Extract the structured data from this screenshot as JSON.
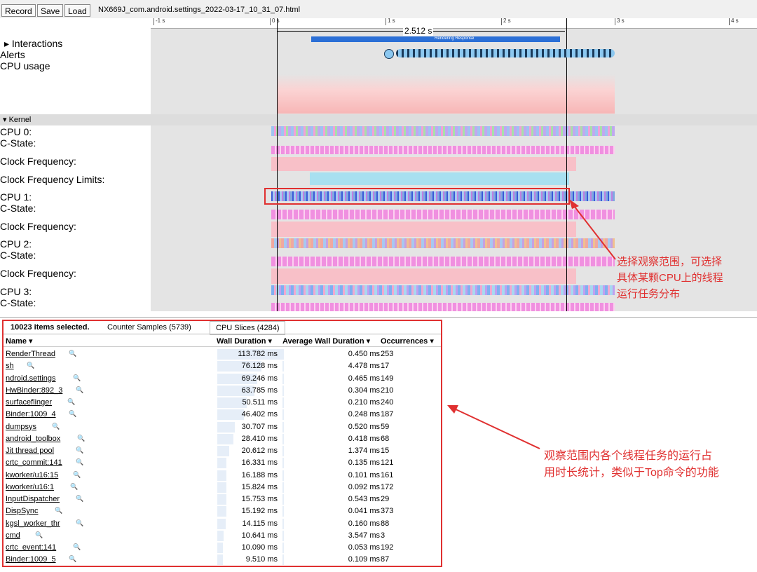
{
  "toolbar": {
    "record": "Record",
    "save": "Save",
    "load": "Load",
    "filename": "NX669J_com.android.settings_2022-03-17_10_31_07.html"
  },
  "ruler": {
    "ticks": [
      "-1 s",
      "0 s",
      "1 s",
      "2 s",
      "3 s",
      "4 s"
    ],
    "selection_duration": "2.512 s",
    "slice_label": "Rendering Response"
  },
  "tracks": {
    "interactions": "▸ Interactions",
    "alerts": "Alerts",
    "cpu_usage": "CPU usage",
    "kernel": "▾ Kernel",
    "cpu0": "CPU 0:",
    "cstate0": "C-State:",
    "clock0": "Clock Frequency:",
    "clocklim0": "Clock Frequency Limits:",
    "cpu1": "CPU 1:",
    "cstate1": "C-State:",
    "clock1": "Clock Frequency:",
    "cpu2": "CPU 2:",
    "cstate2": "C-State:",
    "clock2": "Clock Frequency:",
    "cpu3": "CPU 3:",
    "cstate3": "C-State:"
  },
  "annotation_top": [
    "选择观察范围，可选择",
    "具体某颗CPU上的线程",
    "运行任务分布"
  ],
  "annotation_bottom": [
    "观察范围内各个线程任务的运行占",
    "用时长统计，类似于Top命令的功能"
  ],
  "panel": {
    "selected": "10023 items selected.",
    "tab_counter": "Counter Samples (5739)",
    "tab_cpu": "CPU Slices (4284)",
    "col_name": "Name",
    "col_wall": "Wall Duration",
    "col_avg": "Average Wall Duration",
    "col_occ": "Occurrences",
    "sort_arrow": "▾"
  },
  "rows": [
    {
      "name": "RenderThread",
      "wall": "113.782 ms",
      "avg": "0.450 ms",
      "occ": "253",
      "wall_ms": 113.782
    },
    {
      "name": "sh",
      "wall": "76.128 ms",
      "avg": "4.478 ms",
      "occ": "17",
      "wall_ms": 76.128
    },
    {
      "name": "ndroid.settings",
      "wall": "69.246 ms",
      "avg": "0.465 ms",
      "occ": "149",
      "wall_ms": 69.246
    },
    {
      "name": "HwBinder:892_3",
      "wall": "63.785 ms",
      "avg": "0.304 ms",
      "occ": "210",
      "wall_ms": 63.785
    },
    {
      "name": "surfaceflinger",
      "wall": "50.511 ms",
      "avg": "0.210 ms",
      "occ": "240",
      "wall_ms": 50.511
    },
    {
      "name": "Binder:1009_4",
      "wall": "46.402 ms",
      "avg": "0.248 ms",
      "occ": "187",
      "wall_ms": 46.402
    },
    {
      "name": "dumpsys",
      "wall": "30.707 ms",
      "avg": "0.520 ms",
      "occ": "59",
      "wall_ms": 30.707
    },
    {
      "name": "android_toolbox",
      "wall": "28.410 ms",
      "avg": "0.418 ms",
      "occ": "68",
      "wall_ms": 28.41
    },
    {
      "name": "Jit thread pool",
      "wall": "20.612 ms",
      "avg": "1.374 ms",
      "occ": "15",
      "wall_ms": 20.612
    },
    {
      "name": "crtc_commit:141",
      "wall": "16.331 ms",
      "avg": "0.135 ms",
      "occ": "121",
      "wall_ms": 16.331
    },
    {
      "name": "kworker/u16:15",
      "wall": "16.188 ms",
      "avg": "0.101 ms",
      "occ": "161",
      "wall_ms": 16.188
    },
    {
      "name": "kworker/u16:1",
      "wall": "15.824 ms",
      "avg": "0.092 ms",
      "occ": "172",
      "wall_ms": 15.824
    },
    {
      "name": "InputDispatcher",
      "wall": "15.753 ms",
      "avg": "0.543 ms",
      "occ": "29",
      "wall_ms": 15.753
    },
    {
      "name": "DispSync",
      "wall": "15.192 ms",
      "avg": "0.041 ms",
      "occ": "373",
      "wall_ms": 15.192
    },
    {
      "name": "kgsl_worker_thr",
      "wall": "14.115 ms",
      "avg": "0.160 ms",
      "occ": "88",
      "wall_ms": 14.115
    },
    {
      "name": "cmd",
      "wall": "10.641 ms",
      "avg": "3.547 ms",
      "occ": "3",
      "wall_ms": 10.641
    },
    {
      "name": "crtc_event:141",
      "wall": "10.090 ms",
      "avg": "0.053 ms",
      "occ": "192",
      "wall_ms": 10.09
    },
    {
      "name": "Binder:1009_5",
      "wall": "9.510 ms",
      "avg": "0.109 ms",
      "occ": "87",
      "wall_ms": 9.51
    }
  ],
  "colors": {
    "annotation": "#e03030",
    "selection": "#2b6fd6",
    "magnifier": "#2b4dcc"
  }
}
